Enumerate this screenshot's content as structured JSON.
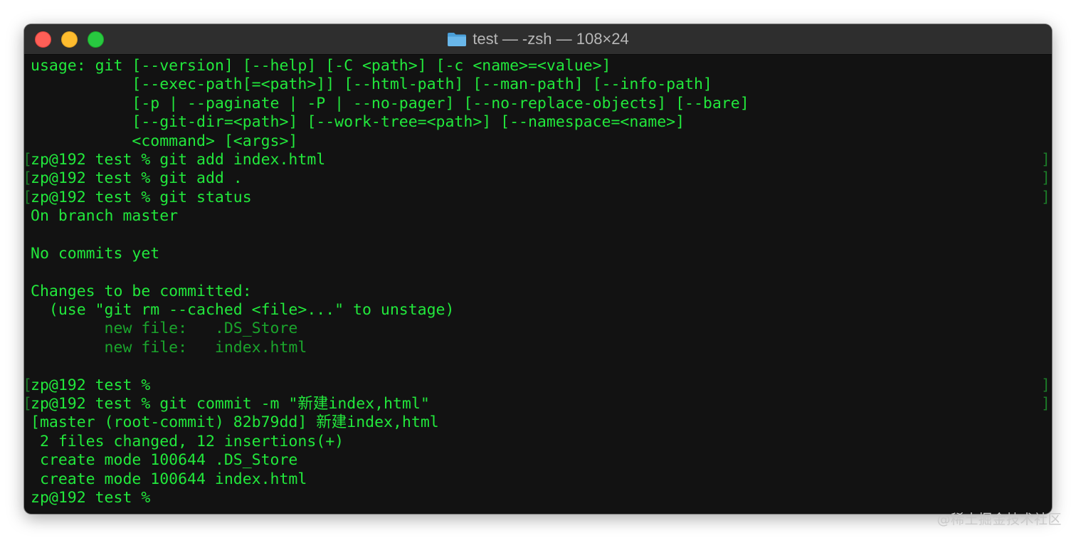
{
  "window": {
    "title": "test — -zsh — 108×24",
    "folder_icon": "folder-icon"
  },
  "colors": {
    "terminal_bg": "#121212",
    "text_green": "#22e83c",
    "dim_green": "#1aa42c",
    "titlebar_bg": "#2e2e2e",
    "close": "#ff5f57",
    "minimize": "#febc2e",
    "zoom": "#28c840"
  },
  "terminal": {
    "lines": [
      {
        "text": "usage: git [--version] [--help] [-C <path>] [-c <name>=<value>]",
        "dim": false,
        "marked": false
      },
      {
        "text": "           [--exec-path[=<path>]] [--html-path] [--man-path] [--info-path]",
        "dim": false,
        "marked": false
      },
      {
        "text": "           [-p | --paginate | -P | --no-pager] [--no-replace-objects] [--bare]",
        "dim": false,
        "marked": false
      },
      {
        "text": "           [--git-dir=<path>] [--work-tree=<path>] [--namespace=<name>]",
        "dim": false,
        "marked": false
      },
      {
        "text": "           <command> [<args>]",
        "dim": false,
        "marked": false
      },
      {
        "text": "zp@192 test % git add index.html",
        "dim": false,
        "marked": true
      },
      {
        "text": "zp@192 test % git add .",
        "dim": false,
        "marked": true
      },
      {
        "text": "zp@192 test % git status",
        "dim": false,
        "marked": true
      },
      {
        "text": "On branch master",
        "dim": false,
        "marked": false
      },
      {
        "text": "",
        "dim": false,
        "marked": false
      },
      {
        "text": "No commits yet",
        "dim": false,
        "marked": false
      },
      {
        "text": "",
        "dim": false,
        "marked": false
      },
      {
        "text": "Changes to be committed:",
        "dim": false,
        "marked": false
      },
      {
        "text": "  (use \"git rm --cached <file>...\" to unstage)",
        "dim": false,
        "marked": false
      },
      {
        "text": "        new file:   .DS_Store",
        "dim": true,
        "marked": false
      },
      {
        "text": "        new file:   index.html",
        "dim": true,
        "marked": false
      },
      {
        "text": "",
        "dim": false,
        "marked": false
      },
      {
        "text": "zp@192 test %",
        "dim": false,
        "marked": true
      },
      {
        "text": "zp@192 test % git commit -m \"新建index,html\"",
        "dim": false,
        "marked": true
      },
      {
        "text": "[master (root-commit) 82b79dd] 新建index,html",
        "dim": false,
        "marked": false
      },
      {
        "text": " 2 files changed, 12 insertions(+)",
        "dim": false,
        "marked": false
      },
      {
        "text": " create mode 100644 .DS_Store",
        "dim": false,
        "marked": false
      },
      {
        "text": " create mode 100644 index.html",
        "dim": false,
        "marked": false
      },
      {
        "text": "zp@192 test %",
        "dim": false,
        "marked": false
      }
    ],
    "mark_left": "[",
    "mark_right": "]"
  },
  "watermark": "@稀土掘金技术社区"
}
